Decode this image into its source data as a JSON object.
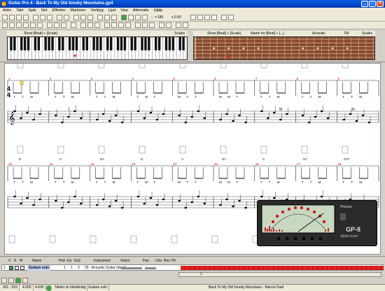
{
  "window": {
    "title": "Guitar Pro 4 - Back To My Old Smoky Mountains.gp4"
  },
  "menu": [
    "Arkiv",
    "Takt",
    "Spår",
    "Not",
    "Effekter",
    "Markörer",
    "Verktyg",
    "Ljud",
    "Visa",
    "Alternativ",
    "Hjälp"
  ],
  "toolbar": {
    "tempo": "180",
    "speed": "x 0.50"
  },
  "instrument_panel": {
    "left_show": "Show [Beat] + [Scale]",
    "left_scales": "Scales",
    "right_show": "Show [Beat] + [Scale]",
    "right_name": "Name for [Beat] + [...]",
    "right_acoustic": "Acoustic",
    "right_fill": "Fill",
    "right_scales": "Scales"
  },
  "score": {
    "time_sig_top": "4",
    "time_sig_bottom": "4",
    "row1_measures": [
      "1",
      "2",
      "3",
      "4",
      "5",
      "6",
      "7",
      "8",
      "9"
    ],
    "row2_measures": [
      "10",
      "11",
      "12",
      "13",
      "14",
      "15",
      "16",
      "17",
      "18"
    ],
    "chords_row2": [
      "D",
      "C",
      "D7",
      "G",
      "A",
      "G7",
      "C",
      "G7",
      "C#7"
    ],
    "pm_marks": [
      "T",
      "T",
      "M",
      "T",
      "T",
      "M",
      "T",
      "T",
      "M",
      "T",
      "M",
      "T",
      "M",
      "T",
      "T",
      "M",
      "M",
      "T",
      "T",
      "T",
      "M",
      "T",
      "T",
      "M",
      "T",
      "T",
      "M"
    ],
    "notes": [
      "7",
      "M",
      "N"
    ]
  },
  "tuner": {
    "brand": "Pioneer",
    "model": "GP-8",
    "subtitle": "digital tuner"
  },
  "tracks": {
    "headers": {
      "v": "V",
      "s": "S",
      "m": "M",
      "name": "Name",
      "port": "Port",
      "ka": "Ka",
      "ka2": "Ka2",
      "instrument": "Instrument",
      "volume": "Volym",
      "pan": "Pan",
      "cho": "Cho",
      "rev": "Rev",
      "ph": "Ph"
    },
    "track1": {
      "num": "1",
      "name": "Guitare solo",
      "port": "1",
      "ch1": "1",
      "ch2": "2",
      "instrument": "25 - Acoustic Guitar (steel)"
    },
    "position": "1"
  },
  "status": {
    "page": "001 : 033",
    "tempo1": "4.000",
    "tempo2": "4.000",
    "check": "Takten är fullständig",
    "track": "Guitare solo",
    "song": "Back To My Old Smoky Mountains - Marcel Dadi"
  }
}
